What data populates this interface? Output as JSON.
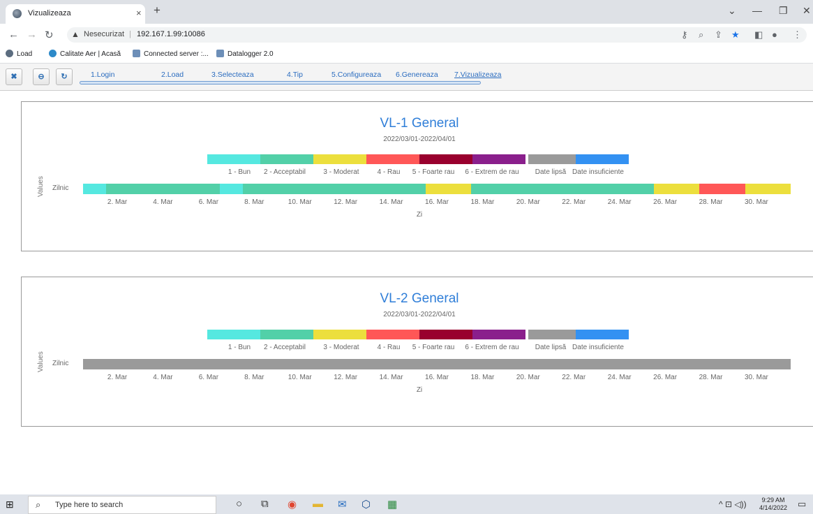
{
  "browser": {
    "tab_title": "Vizualizeaza",
    "tab_close": "×",
    "new_tab": "+",
    "win_controls": [
      "⌄",
      "—",
      "❐",
      "✕"
    ],
    "security_label": "Nesecurizat",
    "url": "192.167.1.99:10086",
    "bookmarks": [
      "Load",
      "Calitate Aer | Acasă",
      "Connected server :...",
      "Datalogger 2.0"
    ]
  },
  "toolbar": {
    "steps": [
      "1.Login",
      "2.Load",
      "3.Selecteaza",
      "4.Tip",
      "5.Configureaza",
      "6.Genereaza",
      "7.Vizualizeaza"
    ],
    "active_step": "7.Vizualizeaza"
  },
  "legend": {
    "items": [
      {
        "label": "1 - Bun",
        "color": "#55e8e0"
      },
      {
        "label": "2 - Acceptabil",
        "color": "#52d0a8"
      },
      {
        "label": "3 - Moderat",
        "color": "#ecdf3d"
      },
      {
        "label": "4 - Rau",
        "color": "#ff5757"
      },
      {
        "label": "5 - Foarte rau",
        "color": "#99002e"
      },
      {
        "label": "6 - Extrem de rau",
        "color": "#8a1f8c"
      },
      {
        "label": "Date lipsă",
        "color": "#9a9a9a"
      },
      {
        "label": "Date insuficiente",
        "color": "#3391f2"
      }
    ]
  },
  "chart_data": [
    {
      "type": "heatmap",
      "title": "VL-1 General",
      "subtitle": "2022/03/01-2022/04/01",
      "ylabel": "Values",
      "xlabel": "Zi",
      "category": "Zilnic",
      "x_ticks": [
        "2. Mar",
        "4. Mar",
        "6. Mar",
        "8. Mar",
        "10. Mar",
        "12. Mar",
        "14. Mar",
        "16. Mar",
        "18. Mar",
        "20. Mar",
        "22. Mar",
        "24. Mar",
        "26. Mar",
        "28. Mar",
        "30. Mar"
      ],
      "days": [
        "1. Mar",
        "2. Mar",
        "3. Mar",
        "4. Mar",
        "5. Mar",
        "6. Mar",
        "7. Mar",
        "8. Mar",
        "9. Mar",
        "10. Mar",
        "11. Mar",
        "12. Mar",
        "13. Mar",
        "14. Mar",
        "15. Mar",
        "16. Mar",
        "17. Mar",
        "18. Mar",
        "19. Mar",
        "20. Mar",
        "21. Mar",
        "22. Mar",
        "23. Mar",
        "24. Mar",
        "25. Mar",
        "26. Mar",
        "27. Mar",
        "28. Mar",
        "29. Mar",
        "30. Mar",
        "31. Mar"
      ],
      "values": [
        1,
        2,
        2,
        2,
        2,
        2,
        1,
        2,
        2,
        2,
        2,
        2,
        2,
        2,
        2,
        3,
        3,
        2,
        2,
        2,
        2,
        2,
        2,
        2,
        2,
        3,
        3,
        4,
        4,
        3,
        3
      ]
    },
    {
      "type": "heatmap",
      "title": "VL-2 General",
      "subtitle": "2022/03/01-2022/04/01",
      "ylabel": "Values",
      "xlabel": "Zi",
      "category": "Zilnic",
      "x_ticks": [
        "2. Mar",
        "4. Mar",
        "6. Mar",
        "8. Mar",
        "10. Mar",
        "12. Mar",
        "14. Mar",
        "16. Mar",
        "18. Mar",
        "20. Mar",
        "22. Mar",
        "24. Mar",
        "26. Mar",
        "28. Mar",
        "30. Mar"
      ],
      "days": [
        "1. Mar",
        "2. Mar",
        "3. Mar",
        "4. Mar",
        "5. Mar",
        "6. Mar",
        "7. Mar",
        "8. Mar",
        "9. Mar",
        "10. Mar",
        "11. Mar",
        "12. Mar",
        "13. Mar",
        "14. Mar",
        "15. Mar",
        "16. Mar",
        "17. Mar",
        "18. Mar",
        "19. Mar",
        "20. Mar",
        "21. Mar",
        "22. Mar",
        "23. Mar",
        "24. Mar",
        "25. Mar",
        "26. Mar",
        "27. Mar",
        "28. Mar",
        "29. Mar",
        "30. Mar",
        "31. Mar"
      ],
      "values": [
        7,
        7,
        7,
        7,
        7,
        7,
        7,
        7,
        7,
        7,
        7,
        7,
        7,
        7,
        7,
        7,
        7,
        7,
        7,
        7,
        7,
        7,
        7,
        7,
        7,
        7,
        7,
        7,
        7,
        7,
        7
      ]
    }
  ],
  "taskbar": {
    "search_placeholder": "Type here to search",
    "time": "9:29 AM",
    "date": "4/14/2022"
  }
}
